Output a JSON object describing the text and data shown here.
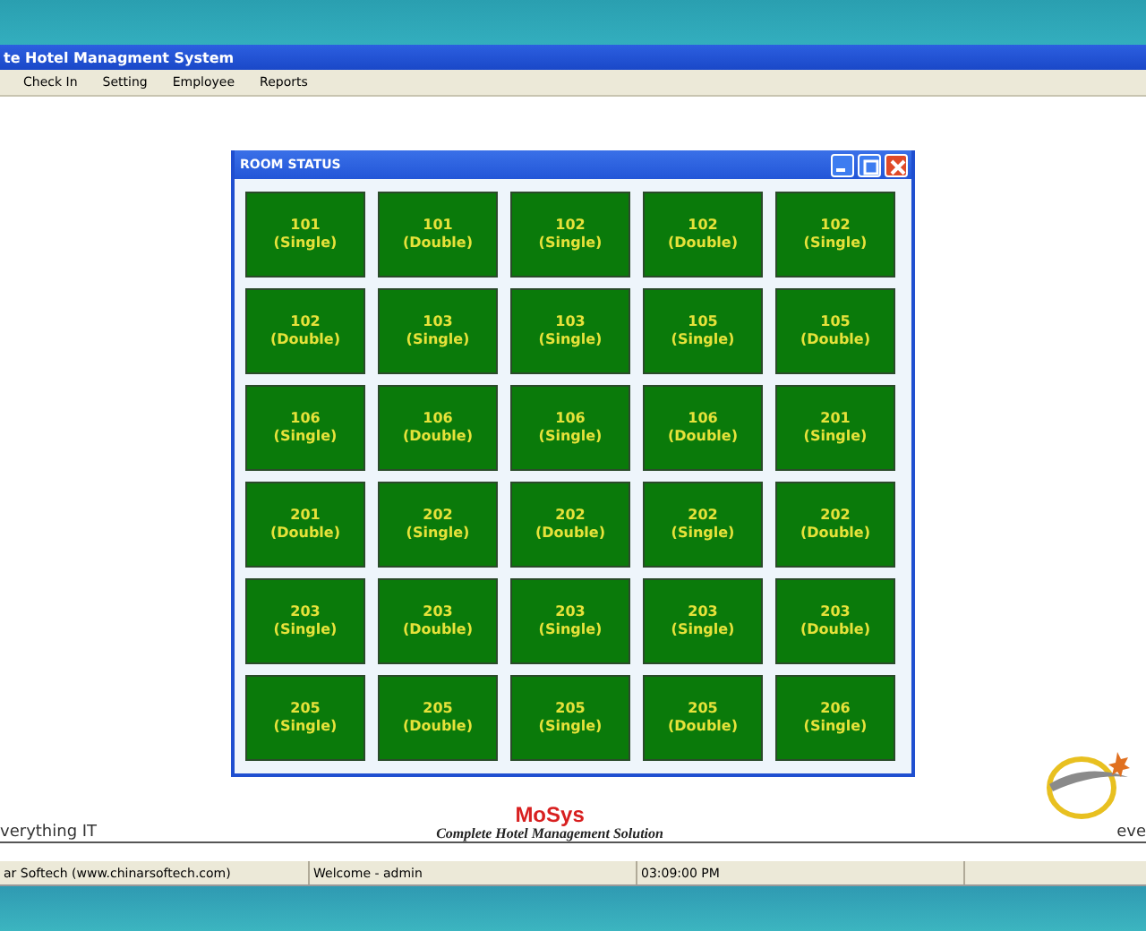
{
  "window": {
    "title": "te Hotel Managment System"
  },
  "menu": [
    "Check In",
    "Setting",
    "Employee",
    "Reports"
  ],
  "room_status": {
    "title": "ROOM STATUS",
    "rooms": [
      {
        "number": "101",
        "type": "(Single)"
      },
      {
        "number": "101",
        "type": "(Double)"
      },
      {
        "number": "102",
        "type": "(Single)"
      },
      {
        "number": "102",
        "type": "(Double)"
      },
      {
        "number": "102",
        "type": "(Single)"
      },
      {
        "number": "102",
        "type": "(Double)"
      },
      {
        "number": "103",
        "type": "(Single)"
      },
      {
        "number": "103",
        "type": "(Single)"
      },
      {
        "number": "105",
        "type": "(Single)"
      },
      {
        "number": "105",
        "type": "(Double)"
      },
      {
        "number": "106",
        "type": "(Single)"
      },
      {
        "number": "106",
        "type": "(Double)"
      },
      {
        "number": "106",
        "type": "(Single)"
      },
      {
        "number": "106",
        "type": "(Double)"
      },
      {
        "number": "201",
        "type": "(Single)"
      },
      {
        "number": "201",
        "type": "(Double)"
      },
      {
        "number": "202",
        "type": "(Single)"
      },
      {
        "number": "202",
        "type": "(Double)"
      },
      {
        "number": "202",
        "type": "(Single)"
      },
      {
        "number": "202",
        "type": "(Double)"
      },
      {
        "number": "203",
        "type": "(Single)"
      },
      {
        "number": "203",
        "type": "(Double)"
      },
      {
        "number": "203",
        "type": "(Single)"
      },
      {
        "number": "203",
        "type": "(Single)"
      },
      {
        "number": "203",
        "type": "(Double)"
      },
      {
        "number": "205",
        "type": "(Single)"
      },
      {
        "number": "205",
        "type": "(Double)"
      },
      {
        "number": "205",
        "type": "(Single)"
      },
      {
        "number": "205",
        "type": "(Double)"
      },
      {
        "number": "206",
        "type": "(Single)"
      }
    ]
  },
  "branding": {
    "left_slogan": "verything IT",
    "logo": "MoSys",
    "tagline": "Complete Hotel Management Solution",
    "right_slogan": "eve"
  },
  "status_bar": [
    "ar Softech (www.chinarsoftech.com)",
    "Welcome - admin",
    "03:09:00 PM"
  ]
}
